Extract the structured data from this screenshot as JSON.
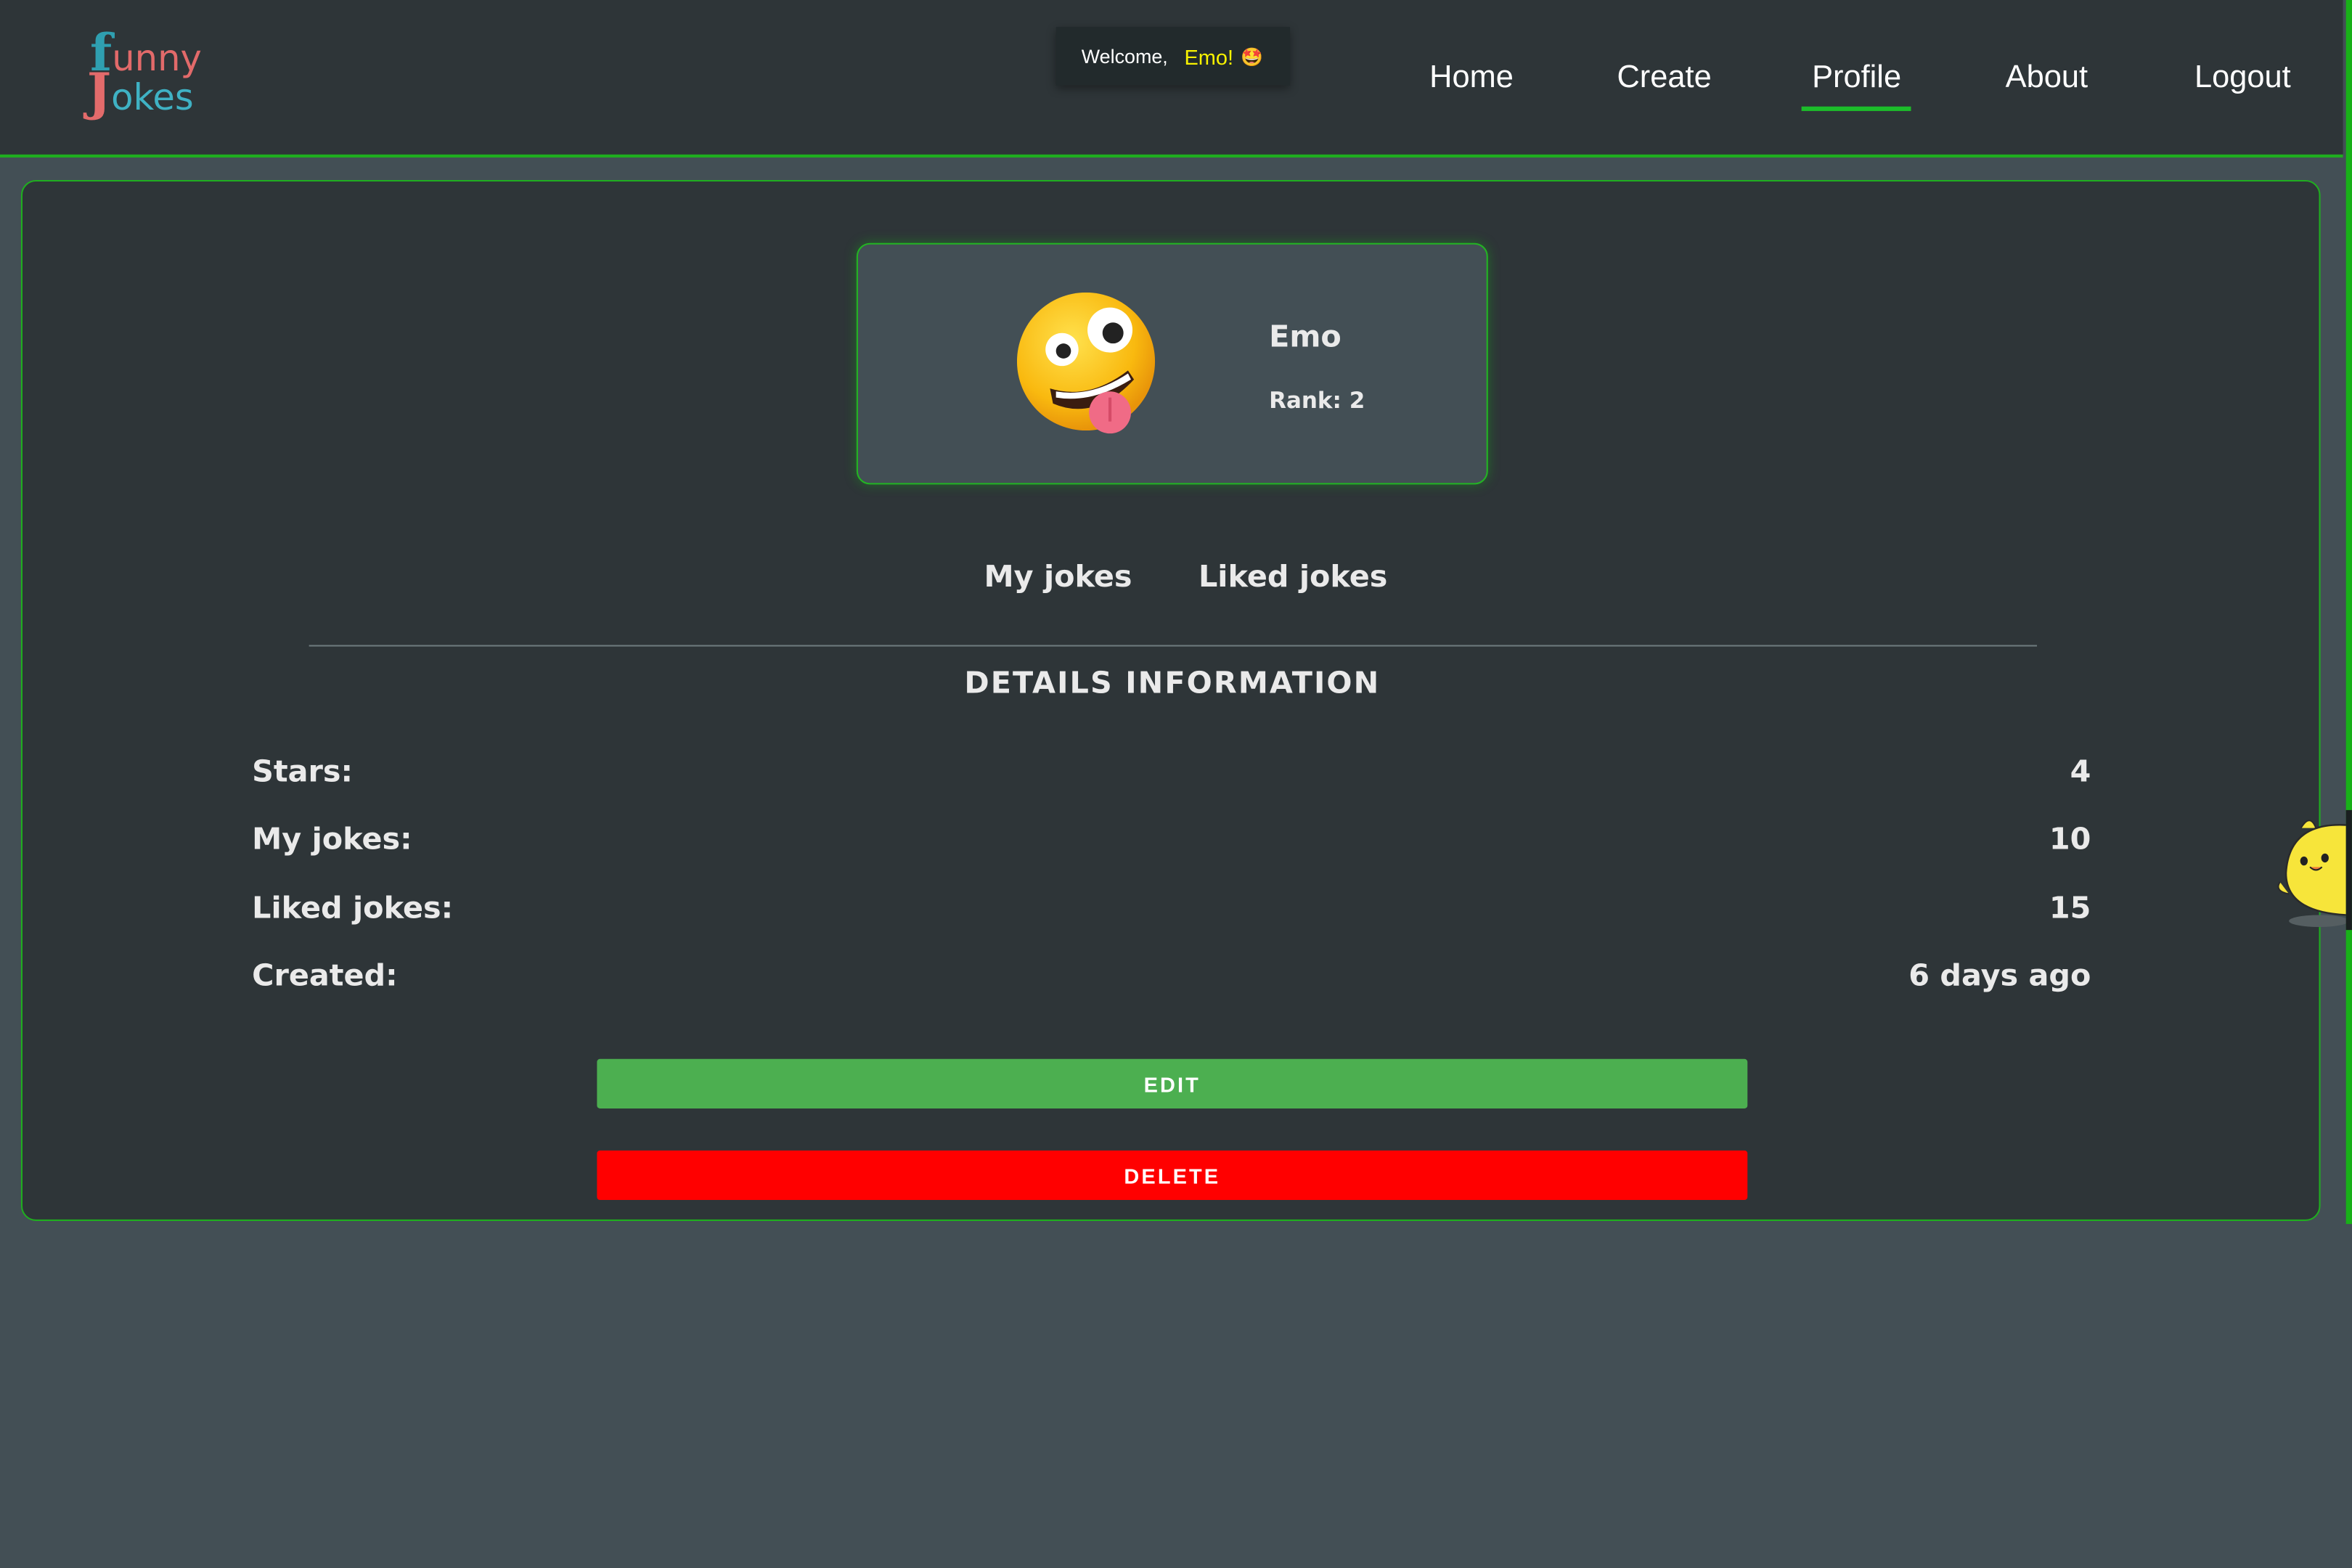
{
  "header": {
    "logo": {
      "line1_initial": "f",
      "line1_rest": "unny",
      "line2_initial": "J",
      "line2_rest": "okes"
    },
    "welcome": {
      "label": "Welcome,",
      "username": "Emo!",
      "emoji": "🤩"
    },
    "nav": [
      {
        "label": "Home",
        "active": false
      },
      {
        "label": "Create",
        "active": false
      },
      {
        "label": "Profile",
        "active": true
      },
      {
        "label": "About",
        "active": false
      },
      {
        "label": "Logout",
        "active": false
      }
    ]
  },
  "profile": {
    "avatar_icon": "zany-face-emoji",
    "username": "Emo",
    "rank_text": "Rank: 2"
  },
  "tabs": [
    {
      "label": "My jokes"
    },
    {
      "label": "Liked jokes"
    }
  ],
  "details": {
    "title": "DETAILS INFORMATION",
    "rows": [
      {
        "label": "Stars:",
        "value": "4"
      },
      {
        "label": "My jokes:",
        "value": "10"
      },
      {
        "label": "Liked jokes:",
        "value": "15"
      },
      {
        "label": "Created:",
        "value": "6 days ago"
      }
    ]
  },
  "actions": {
    "edit_label": "EDIT",
    "delete_label": "DELETE"
  },
  "colors": {
    "accent_green": "#1fae1f",
    "header_bg": "#2e3538",
    "page_bg": "#434f55",
    "edit_button": "#4caf50",
    "delete_button": "#ff0000",
    "welcome_name": "#f8f200"
  }
}
